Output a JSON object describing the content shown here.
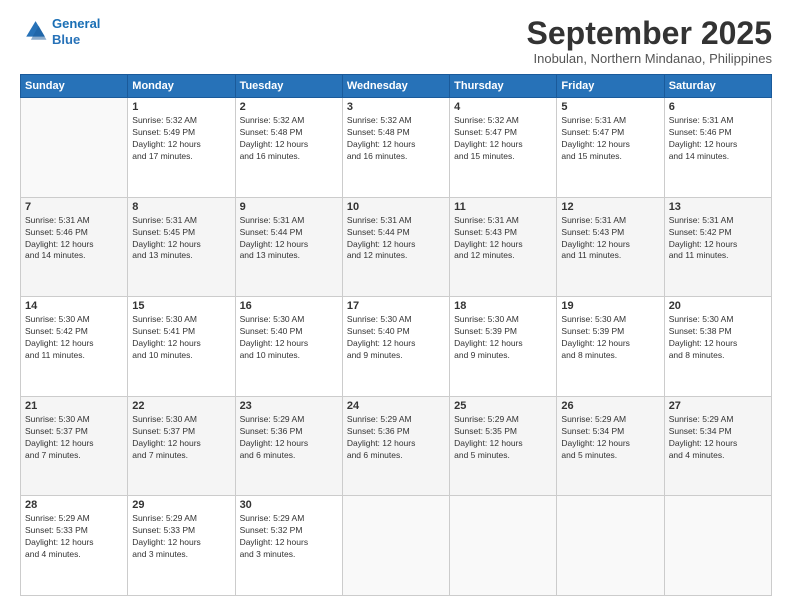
{
  "header": {
    "logo": {
      "line1": "General",
      "line2": "Blue"
    },
    "month": "September 2025",
    "location": "Inobulan, Northern Mindanao, Philippines"
  },
  "weekdays": [
    "Sunday",
    "Monday",
    "Tuesday",
    "Wednesday",
    "Thursday",
    "Friday",
    "Saturday"
  ],
  "days": [
    {
      "num": "",
      "info": ""
    },
    {
      "num": "1",
      "info": "Sunrise: 5:32 AM\nSunset: 5:49 PM\nDaylight: 12 hours\nand 17 minutes."
    },
    {
      "num": "2",
      "info": "Sunrise: 5:32 AM\nSunset: 5:48 PM\nDaylight: 12 hours\nand 16 minutes."
    },
    {
      "num": "3",
      "info": "Sunrise: 5:32 AM\nSunset: 5:48 PM\nDaylight: 12 hours\nand 16 minutes."
    },
    {
      "num": "4",
      "info": "Sunrise: 5:32 AM\nSunset: 5:47 PM\nDaylight: 12 hours\nand 15 minutes."
    },
    {
      "num": "5",
      "info": "Sunrise: 5:31 AM\nSunset: 5:47 PM\nDaylight: 12 hours\nand 15 minutes."
    },
    {
      "num": "6",
      "info": "Sunrise: 5:31 AM\nSunset: 5:46 PM\nDaylight: 12 hours\nand 14 minutes."
    },
    {
      "num": "7",
      "info": "Sunrise: 5:31 AM\nSunset: 5:46 PM\nDaylight: 12 hours\nand 14 minutes."
    },
    {
      "num": "8",
      "info": "Sunrise: 5:31 AM\nSunset: 5:45 PM\nDaylight: 12 hours\nand 13 minutes."
    },
    {
      "num": "9",
      "info": "Sunrise: 5:31 AM\nSunset: 5:44 PM\nDaylight: 12 hours\nand 13 minutes."
    },
    {
      "num": "10",
      "info": "Sunrise: 5:31 AM\nSunset: 5:44 PM\nDaylight: 12 hours\nand 12 minutes."
    },
    {
      "num": "11",
      "info": "Sunrise: 5:31 AM\nSunset: 5:43 PM\nDaylight: 12 hours\nand 12 minutes."
    },
    {
      "num": "12",
      "info": "Sunrise: 5:31 AM\nSunset: 5:43 PM\nDaylight: 12 hours\nand 11 minutes."
    },
    {
      "num": "13",
      "info": "Sunrise: 5:31 AM\nSunset: 5:42 PM\nDaylight: 12 hours\nand 11 minutes."
    },
    {
      "num": "14",
      "info": "Sunrise: 5:30 AM\nSunset: 5:42 PM\nDaylight: 12 hours\nand 11 minutes."
    },
    {
      "num": "15",
      "info": "Sunrise: 5:30 AM\nSunset: 5:41 PM\nDaylight: 12 hours\nand 10 minutes."
    },
    {
      "num": "16",
      "info": "Sunrise: 5:30 AM\nSunset: 5:40 PM\nDaylight: 12 hours\nand 10 minutes."
    },
    {
      "num": "17",
      "info": "Sunrise: 5:30 AM\nSunset: 5:40 PM\nDaylight: 12 hours\nand 9 minutes."
    },
    {
      "num": "18",
      "info": "Sunrise: 5:30 AM\nSunset: 5:39 PM\nDaylight: 12 hours\nand 9 minutes."
    },
    {
      "num": "19",
      "info": "Sunrise: 5:30 AM\nSunset: 5:39 PM\nDaylight: 12 hours\nand 8 minutes."
    },
    {
      "num": "20",
      "info": "Sunrise: 5:30 AM\nSunset: 5:38 PM\nDaylight: 12 hours\nand 8 minutes."
    },
    {
      "num": "21",
      "info": "Sunrise: 5:30 AM\nSunset: 5:37 PM\nDaylight: 12 hours\nand 7 minutes."
    },
    {
      "num": "22",
      "info": "Sunrise: 5:30 AM\nSunset: 5:37 PM\nDaylight: 12 hours\nand 7 minutes."
    },
    {
      "num": "23",
      "info": "Sunrise: 5:29 AM\nSunset: 5:36 PM\nDaylight: 12 hours\nand 6 minutes."
    },
    {
      "num": "24",
      "info": "Sunrise: 5:29 AM\nSunset: 5:36 PM\nDaylight: 12 hours\nand 6 minutes."
    },
    {
      "num": "25",
      "info": "Sunrise: 5:29 AM\nSunset: 5:35 PM\nDaylight: 12 hours\nand 5 minutes."
    },
    {
      "num": "26",
      "info": "Sunrise: 5:29 AM\nSunset: 5:34 PM\nDaylight: 12 hours\nand 5 minutes."
    },
    {
      "num": "27",
      "info": "Sunrise: 5:29 AM\nSunset: 5:34 PM\nDaylight: 12 hours\nand 4 minutes."
    },
    {
      "num": "28",
      "info": "Sunrise: 5:29 AM\nSunset: 5:33 PM\nDaylight: 12 hours\nand 4 minutes."
    },
    {
      "num": "29",
      "info": "Sunrise: 5:29 AM\nSunset: 5:33 PM\nDaylight: 12 hours\nand 3 minutes."
    },
    {
      "num": "30",
      "info": "Sunrise: 5:29 AM\nSunset: 5:32 PM\nDaylight: 12 hours\nand 3 minutes."
    },
    {
      "num": "",
      "info": ""
    },
    {
      "num": "",
      "info": ""
    },
    {
      "num": "",
      "info": ""
    },
    {
      "num": "",
      "info": ""
    }
  ]
}
